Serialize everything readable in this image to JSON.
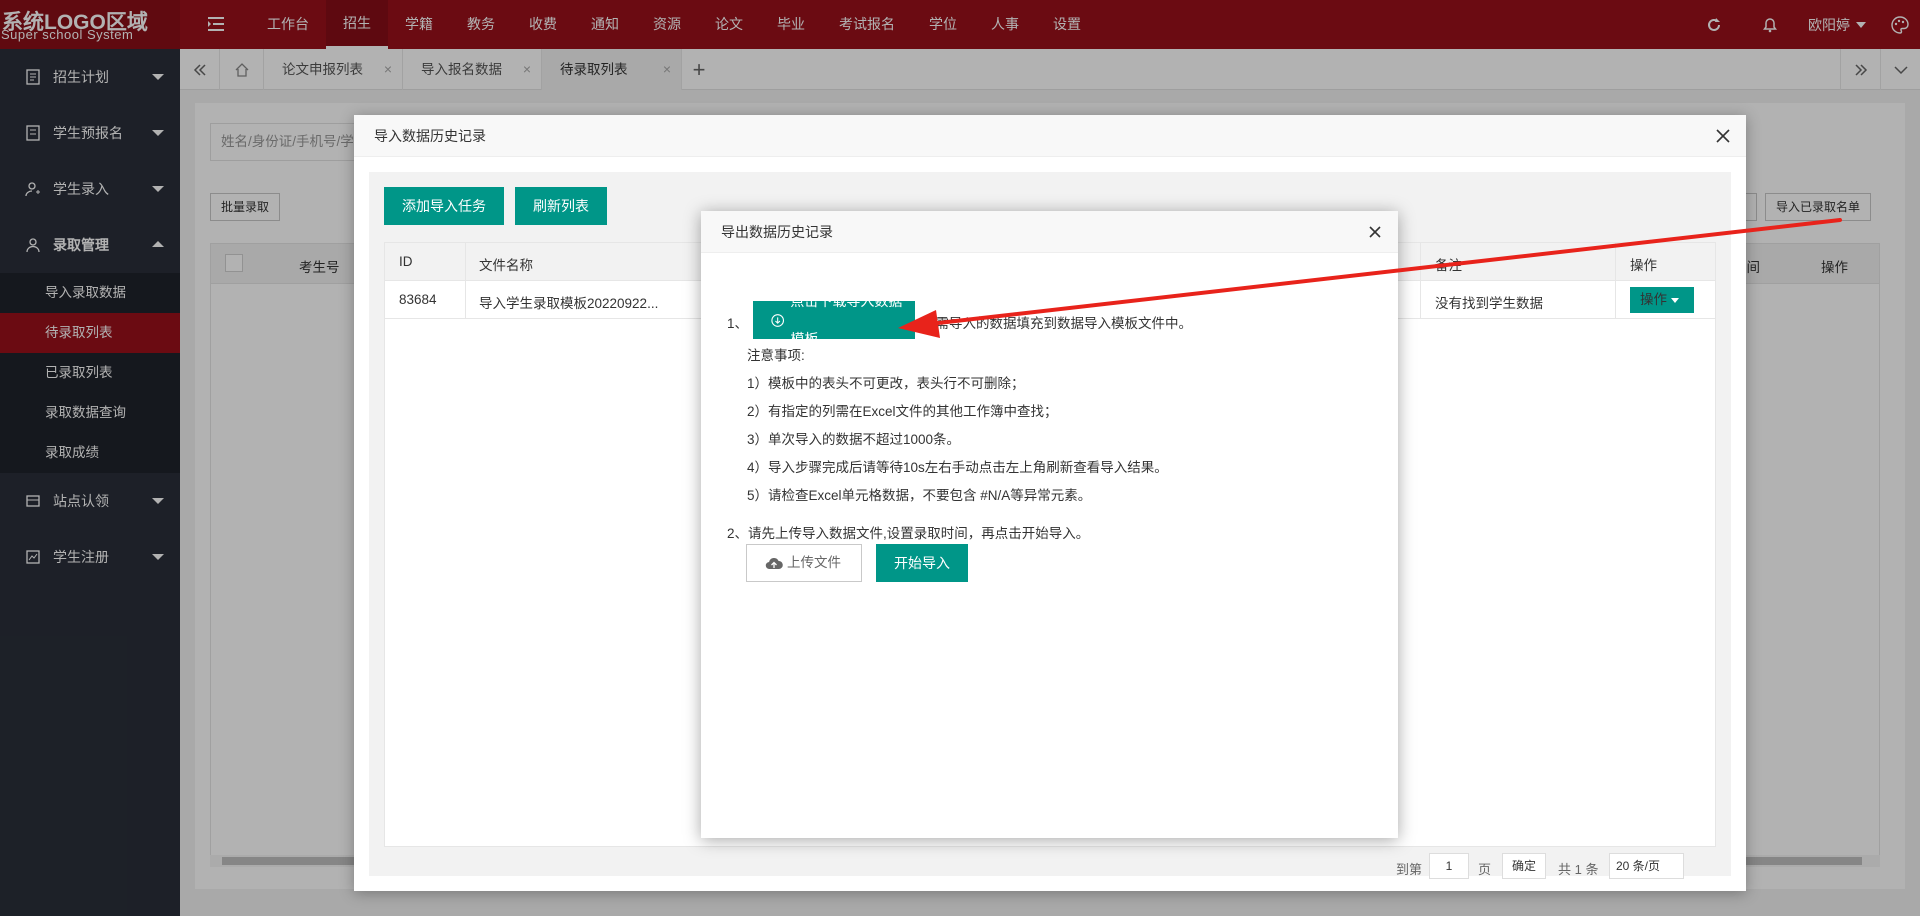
{
  "topbar": {
    "logo_line1": "系统LOGO区域",
    "logo_line2": "Super school System",
    "nav": [
      "工作台",
      "招生",
      "学籍",
      "教务",
      "收费",
      "通知",
      "资源",
      "论文",
      "毕业",
      "考试报名",
      "学位",
      "人事",
      "设置"
    ],
    "active_nav": "招生",
    "user": "欧阳婷"
  },
  "sidebar": {
    "groups": [
      {
        "label": "招生计划",
        "icon": "doc-icon"
      },
      {
        "label": "学生预报名",
        "icon": "form-icon"
      },
      {
        "label": "学生录入",
        "icon": "user-add-icon"
      },
      {
        "label": "录取管理",
        "icon": "user-icon"
      },
      {
        "label": "站点认领",
        "icon": "site-icon"
      },
      {
        "label": "学生注册",
        "icon": "register-icon"
      }
    ],
    "sub_items": [
      "导入录取数据",
      "待录取列表",
      "已录取列表",
      "录取数据查询",
      "录取成绩"
    ],
    "active_sub": "待录取列表"
  },
  "tabs": {
    "items": [
      {
        "label": "论文申报列表"
      },
      {
        "label": "导入报名数据"
      },
      {
        "label": "待录取列表"
      }
    ],
    "active": "待录取列表"
  },
  "page": {
    "search_placeholder": "姓名/身份证/手机号/学",
    "batch_button": "批量录取",
    "right_button_partial": "号",
    "import_admitted_button": "导入已录取名单",
    "headers": {
      "examinee_no": "考生号",
      "time": "时间",
      "action": "操作"
    }
  },
  "dialog1": {
    "title": "导入数据历史记录",
    "add_task": "添加导入任务",
    "refresh": "刷新列表",
    "headers": {
      "id": "ID",
      "file": "文件名称",
      "remark": "备注",
      "action": "操作"
    },
    "rows": [
      {
        "id": "83684",
        "file": "导入学生录取模板20220922...",
        "remark": "没有找到学生数据",
        "action": "操作"
      }
    ],
    "pager": {
      "goto_partial": "到第",
      "page_value": "1",
      "page_unit": "页",
      "confirm": "确定",
      "total": "共 1 条",
      "page_size": "20 条/页"
    }
  },
  "dialog2": {
    "title": "导出数据历史记录",
    "step1_num": "1、",
    "download_btn": "点击下载导入数据模板",
    "step1_tail": "将需导入的数据填充到数据导入模板文件中。",
    "notes_title": "注意事项:",
    "notes": [
      "1）模板中的表头不可更改，表头行不可删除；",
      "2）有指定的列需在Excel文件的其他工作簿中查找；",
      "3）单次导入的数据不超过1000条。",
      "4）导入步骤完成后请等待10s左右手动点击左上角刷新查看导入结果。",
      "5）请检查Excel单元格数据，不要包含 #N/A等异常元素。"
    ],
    "step2": "2、请先上传导入数据文件,设置录取时间，再点击开始导入。",
    "upload_btn": "上传文件",
    "start_btn": "开始导入"
  },
  "colors": {
    "brand": "#9a111b",
    "teal": "#009688",
    "arrow": "#e8231b",
    "sidebar_bg": "#2a2f3a"
  }
}
